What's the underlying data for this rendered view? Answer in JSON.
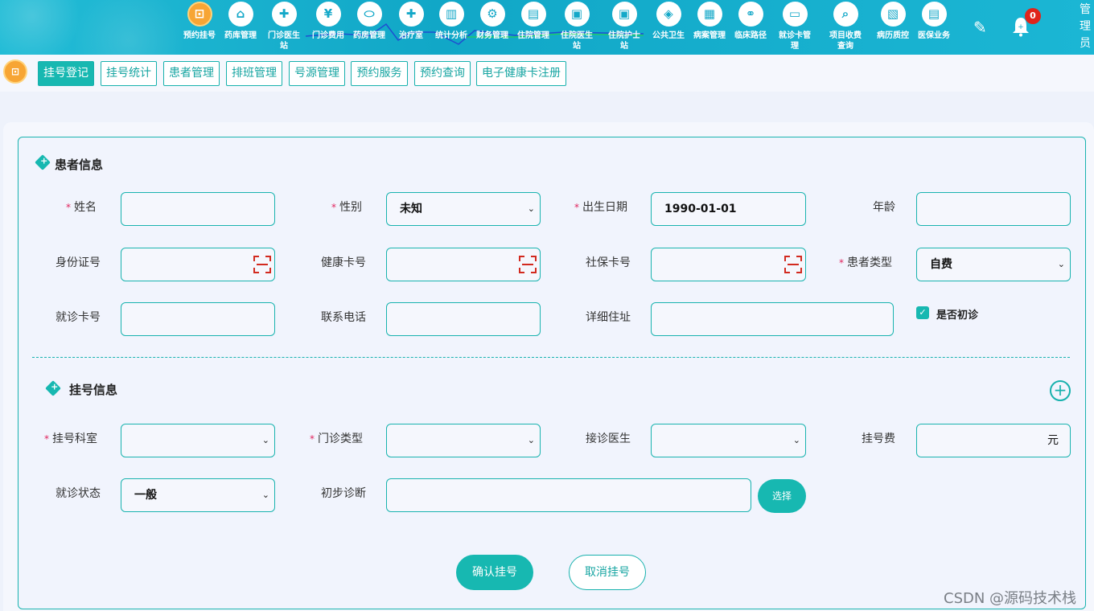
{
  "nav": {
    "items": [
      {
        "label": "预约挂号",
        "icon": "calendar-icon",
        "glyph": "⊡"
      },
      {
        "label": "药库管理",
        "icon": "warehouse-icon",
        "glyph": "⌂"
      },
      {
        "label": "门诊医生站",
        "icon": "doctor-icon",
        "glyph": "✚"
      },
      {
        "label": "门诊费用",
        "icon": "yen-icon",
        "glyph": "¥"
      },
      {
        "label": "药房管理",
        "icon": "pill-icon",
        "glyph": "⬭"
      },
      {
        "label": "治疗室",
        "icon": "nurse-icon",
        "glyph": "✚"
      },
      {
        "label": "统计分析",
        "icon": "chart-icon",
        "glyph": "▥"
      },
      {
        "label": "财务管理",
        "icon": "finance-icon",
        "glyph": "⚙"
      },
      {
        "label": "住院管理",
        "icon": "bed-icon",
        "glyph": "▤"
      },
      {
        "label": "住院医生站",
        "icon": "inpatient-doctor-icon",
        "glyph": "▣"
      },
      {
        "label": "住院护士站",
        "icon": "inpatient-nurse-icon",
        "glyph": "▣"
      },
      {
        "label": "公共卫生",
        "icon": "public-health-icon",
        "glyph": "◈"
      },
      {
        "label": "病案管理",
        "icon": "medical-record-icon",
        "glyph": "▦"
      },
      {
        "label": "临床路径",
        "icon": "clinical-path-icon",
        "glyph": "⚭"
      },
      {
        "label": "就诊卡管理",
        "icon": "card-icon",
        "glyph": "▭"
      },
      {
        "label": "项目收费查询",
        "icon": "fee-query-icon",
        "glyph": "⌕"
      },
      {
        "label": "病历质控",
        "icon": "quality-icon",
        "glyph": "▧"
      },
      {
        "label": "医保业务",
        "icon": "insurance-icon",
        "glyph": "▤"
      }
    ],
    "badge_count": "0",
    "user": "管理员"
  },
  "tabs": [
    "挂号登记",
    "挂号统计",
    "患者管理",
    "排班管理",
    "号源管理",
    "预约服务",
    "预约查询",
    "电子健康卡注册"
  ],
  "patient": {
    "title": "患者信息",
    "name_label": "姓名",
    "gender_label": "性别",
    "gender_value": "未知",
    "birth_label": "出生日期",
    "birth_value": "1990-01-01",
    "age_label": "年龄",
    "id_label": "身份证号",
    "health_card_label": "健康卡号",
    "social_card_label": "社保卡号",
    "type_label": "患者类型",
    "type_value": "自费",
    "visit_card_label": "就诊卡号",
    "phone_label": "联系电话",
    "address_label": "详细住址",
    "first_visit_label": "是否初诊"
  },
  "registration": {
    "title": "挂号信息",
    "dept_label": "挂号科室",
    "clinic_type_label": "门诊类型",
    "doctor_label": "接诊医生",
    "fee_label": "挂号费",
    "fee_unit": "元",
    "status_label": "就诊状态",
    "status_value": "一般",
    "diagnosis_label": "初步诊断",
    "choose_label": "选择"
  },
  "actions": {
    "confirm": "确认挂号",
    "cancel": "取消挂号"
  },
  "watermark": "CSDN @源码技术栈",
  "colors": {
    "accent": "#17b8b1",
    "topbar": "#11a7c7",
    "active_icon": "#f7a534",
    "required": "#e0245e"
  }
}
